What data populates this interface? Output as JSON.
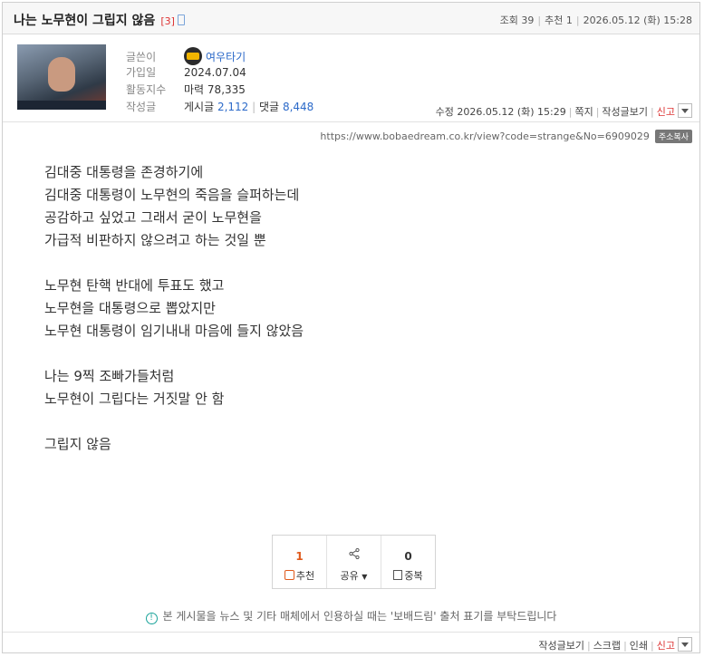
{
  "post": {
    "title": "나는 노무현이 그립지 않음",
    "reply_count": "[3]",
    "views_label": "조회",
    "views": "39",
    "recommend_label": "추천",
    "recommend": "1",
    "date": "2026.05.12 (화) 15:28"
  },
  "author": {
    "writer_label": "글쓴이",
    "nickname": "여우타기",
    "joined_label": "가입일",
    "joined": "2024.07.04",
    "activity_label": "활동지수",
    "power_label": "마력",
    "power": "78,335",
    "writes_label": "작성글",
    "posts_label": "게시글",
    "posts": "2,112",
    "comments_label": "댓글",
    "comments": "8,448"
  },
  "edit_bar": {
    "edited": "수정 2026.05.12 (화) 15:29",
    "message": "쪽지",
    "view_posts": "작성글보기",
    "report": "신고"
  },
  "url": {
    "text": "https://www.bobaedream.co.kr/view?code=strange&No=6909029",
    "copy_label": "주소복사"
  },
  "body": {
    "lines": [
      "김대중 대통령을 존경하기에",
      "김대중 대통령이 노무현의 죽음을 슬퍼하는데",
      "공감하고 싶었고 그래서 굳이 노무현을",
      "가급적 비판하지 않으려고 하는 것일 뿐",
      "",
      "노무현 탄핵 반대에 투표도 했고",
      "노무현을 대통령으로 뽑았지만",
      "노무현 대통령이 임기내내 마음에 들지 않았음",
      "",
      "나는 9찍 조빠가들처럼",
      "노무현이 그립다는 거짓말 안 함",
      "",
      "그립지 않음"
    ]
  },
  "actions": {
    "recommend_count": "1",
    "recommend_label": "추천",
    "share_label": "공유",
    "dup_count": "0",
    "dup_label": "중복"
  },
  "notice": "본 게시물을 뉴스 및 기타 매체에서 인용하실 때는 '보배드림' 출처 표기를 부탁드립니다",
  "bottom": {
    "view_posts": "작성글보기",
    "scrap": "스크랩",
    "print": "인쇄",
    "report": "신고"
  },
  "colors": {
    "accent_blue": "#2c6ac9",
    "report_red": "#dd3333",
    "recommend_orange": "#e05a1c",
    "notice_teal": "#1aa39a"
  }
}
